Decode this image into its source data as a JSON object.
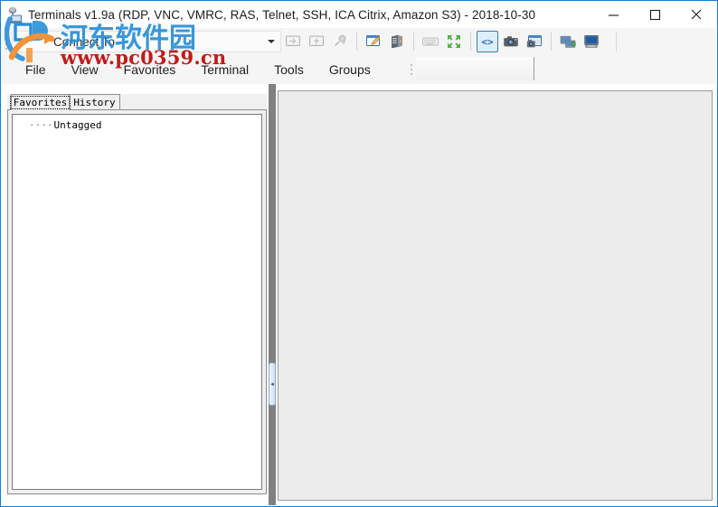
{
  "window": {
    "title": "Terminals v1.9a (RDP, VNC, VMRC, RAS, Telnet, SSH, ICA Citrix, Amazon S3) - 2018-10-30",
    "app_icon": "terminals-app-icon",
    "controls": {
      "minimize": "minimize-icon",
      "maximize": "maximize-icon",
      "close": "close-icon"
    },
    "border_color": "#1b7fcb"
  },
  "toolbar": {
    "connect_to": {
      "label": "Connect To",
      "placeholder": "Connect To",
      "value": "",
      "dropdown_icon": "chevron-down-icon"
    },
    "buttons": [
      {
        "name": "connect-button",
        "icon": "connect-screen-icon",
        "enabled": false,
        "active": false
      },
      {
        "name": "connect-as-button",
        "icon": "connect-screen-arrow-icon",
        "enabled": false,
        "active": false
      },
      {
        "name": "disconnect-button",
        "icon": "plug-icon",
        "enabled": false,
        "active": false
      },
      {
        "name": "new-favorite-button",
        "icon": "edit-window-pencil-icon",
        "enabled": true,
        "active": false
      },
      {
        "name": "organize-favorites-button",
        "icon": "server-rack-icon",
        "enabled": true,
        "active": false
      },
      {
        "name": "send-keys-button",
        "icon": "keyboard-icon",
        "enabled": false,
        "active": false
      },
      {
        "name": "fullscreen-button",
        "icon": "fullscreen-arrows-icon",
        "enabled": true,
        "active": false
      },
      {
        "name": "show-hide-toolstrip-button",
        "icon": "code-brackets-icon",
        "enabled": true,
        "active": true
      },
      {
        "name": "capture-screen-button",
        "icon": "camera-icon",
        "enabled": true,
        "active": false
      },
      {
        "name": "capture-manager-button",
        "icon": "window-camera-icon",
        "enabled": true,
        "active": false
      },
      {
        "name": "network-tools-button",
        "icon": "network-monitor-icon",
        "enabled": true,
        "active": false
      },
      {
        "name": "computer-management-button",
        "icon": "computer-icon",
        "enabled": true,
        "active": false
      }
    ]
  },
  "menubar": {
    "items": [
      {
        "label": "File",
        "name": "menu-file"
      },
      {
        "label": "View",
        "name": "menu-view"
      },
      {
        "label": "Favorites",
        "name": "menu-favorites"
      },
      {
        "label": "Terminal",
        "name": "menu-terminal"
      },
      {
        "label": "Tools",
        "name": "menu-tools"
      },
      {
        "label": "Groups",
        "name": "menu-groups"
      }
    ]
  },
  "sidebar": {
    "tabs": [
      {
        "label": "Favorites",
        "name": "tab-favorites",
        "selected": true
      },
      {
        "label": "History",
        "name": "tab-history",
        "selected": false
      }
    ],
    "tree": {
      "items": [
        {
          "label": "Untagged",
          "prefix": "····",
          "name": "tree-node-untagged"
        }
      ]
    },
    "splitter": {
      "collapse_icon": "chevron-left-icon",
      "label": "◂"
    }
  },
  "main": {
    "content": "",
    "background": "#ececec"
  },
  "watermark": {
    "site_name": "河东软件园",
    "url": "www.pc0359.cn",
    "logo": "pc0359-logo",
    "colors": {
      "site_name": "#2a8fd6",
      "url": "#c11b1b",
      "logo_blue": "#2a8fd6",
      "logo_orange": "#f0933a"
    }
  }
}
